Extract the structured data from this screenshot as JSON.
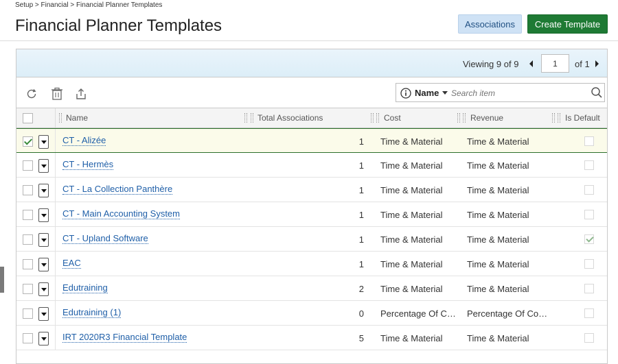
{
  "breadcrumb": "Setup > Financial > Financial Planner Templates",
  "page_title": "Financial Planner Templates",
  "header_buttons": {
    "associations": "Associations",
    "create_template": "Create Template"
  },
  "pager": {
    "viewing_label": "Viewing",
    "viewing_count": "9 of 9",
    "page_value": "1",
    "of_total": "of 1"
  },
  "toolbar": {
    "icons": [
      "refresh-icon",
      "trash-icon",
      "export-icon"
    ]
  },
  "search": {
    "field": "Name",
    "placeholder": "Search item"
  },
  "columns": {
    "name": "Name",
    "total_associations": "Total Associations",
    "cost": "Cost",
    "revenue": "Revenue",
    "is_default": "Is Default"
  },
  "rows": [
    {
      "name": "CT - Alizée",
      "total": "1",
      "cost": "Time & Material",
      "revenue": "Time & Material",
      "selected": true,
      "is_default": false
    },
    {
      "name": "CT - Hermès",
      "total": "1",
      "cost": "Time & Material",
      "revenue": "Time & Material",
      "selected": false,
      "is_default": false
    },
    {
      "name": "CT - La Collection Panthère",
      "total": "1",
      "cost": "Time & Material",
      "revenue": "Time & Material",
      "selected": false,
      "is_default": false
    },
    {
      "name": "CT - Main Accounting System",
      "total": "1",
      "cost": "Time & Material",
      "revenue": "Time & Material",
      "selected": false,
      "is_default": false
    },
    {
      "name": "CT - Upland Software",
      "total": "1",
      "cost": "Time & Material",
      "revenue": "Time & Material",
      "selected": false,
      "is_default": true
    },
    {
      "name": "EAC",
      "total": "1",
      "cost": "Time & Material",
      "revenue": "Time & Material",
      "selected": false,
      "is_default": false
    },
    {
      "name": "Edutraining",
      "total": "2",
      "cost": "Time & Material",
      "revenue": "Time & Material",
      "selected": false,
      "is_default": false
    },
    {
      "name": "Edutraining (1)",
      "total": "0",
      "cost": "Percentage Of Co...",
      "revenue": "Percentage Of Com...",
      "selected": false,
      "is_default": false
    },
    {
      "name": "IRT 2020R3 Financial Template",
      "total": "5",
      "cost": "Time & Material",
      "revenue": "Time & Material",
      "selected": false,
      "is_default": false
    }
  ]
}
